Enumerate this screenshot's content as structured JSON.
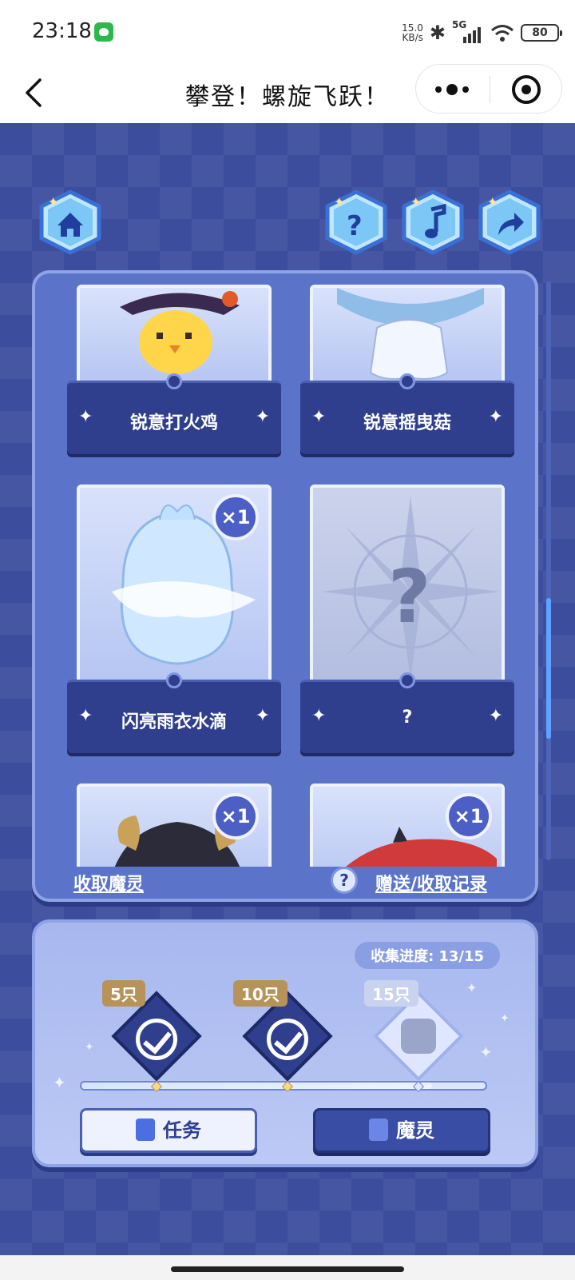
{
  "status_bar": {
    "time": "23:18",
    "net_speed_value": "15.0",
    "net_speed_unit": "KB/s",
    "network": "5G",
    "battery": "80"
  },
  "nav": {
    "title": "攀登！螺旋飞跃！"
  },
  "toolbar": {
    "home_icon": "home-icon",
    "help_icon": "question-icon",
    "music_icon": "music-note-icon",
    "share_icon": "share-arrow-icon"
  },
  "cards": [
    {
      "name": "锐意打火鸡",
      "count": ""
    },
    {
      "name": "锐意摇曳菇",
      "count": ""
    },
    {
      "name": "闪亮雨衣水滴",
      "count": "×1"
    },
    {
      "name": "?",
      "count": ""
    },
    {
      "name": "",
      "count": "×1"
    },
    {
      "name": "",
      "count": "×1"
    }
  ],
  "panel_footer": {
    "collect_link": "收取魔灵",
    "help_mark": "?",
    "record_link": "赠送/收取记录"
  },
  "progress": {
    "label": "收集进度:",
    "value": "13/15",
    "current": 13,
    "total": 15,
    "milestones": [
      {
        "label": "5只",
        "reached": true
      },
      {
        "label": "10只",
        "reached": true
      },
      {
        "label": "15只",
        "reached": false
      }
    ]
  },
  "buttons": {
    "task": "任务",
    "sprite": "魔灵"
  },
  "colors": {
    "background": "#3c4d9e",
    "panel": "#5b74c9",
    "card_base": "#2f3f8e",
    "accent": "#5fa3ff"
  }
}
